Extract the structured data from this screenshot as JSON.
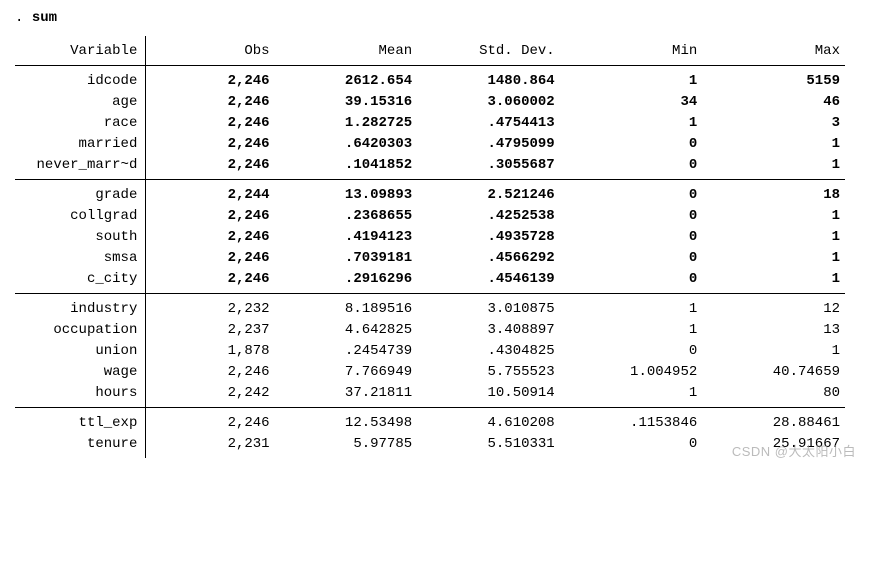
{
  "command_prefix": ". ",
  "command": "sum",
  "headers": {
    "variable": "Variable",
    "obs": "Obs",
    "mean": "Mean",
    "sd": "Std. Dev.",
    "min": "Min",
    "max": "Max"
  },
  "groups": [
    {
      "bold": true,
      "rows": [
        {
          "var": "idcode",
          "obs": "2,246",
          "mean": "2612.654",
          "sd": "1480.864",
          "min": "1",
          "max": "5159"
        },
        {
          "var": "age",
          "obs": "2,246",
          "mean": "39.15316",
          "sd": "3.060002",
          "min": "34",
          "max": "46"
        },
        {
          "var": "race",
          "obs": "2,246",
          "mean": "1.282725",
          "sd": ".4754413",
          "min": "1",
          "max": "3"
        },
        {
          "var": "married",
          "obs": "2,246",
          "mean": ".6420303",
          "sd": ".4795099",
          "min": "0",
          "max": "1"
        },
        {
          "var": "never_marr~d",
          "obs": "2,246",
          "mean": ".1041852",
          "sd": ".3055687",
          "min": "0",
          "max": "1"
        }
      ]
    },
    {
      "bold": true,
      "rows": [
        {
          "var": "grade",
          "obs": "2,244",
          "mean": "13.09893",
          "sd": "2.521246",
          "min": "0",
          "max": "18"
        },
        {
          "var": "collgrad",
          "obs": "2,246",
          "mean": ".2368655",
          "sd": ".4252538",
          "min": "0",
          "max": "1"
        },
        {
          "var": "south",
          "obs": "2,246",
          "mean": ".4194123",
          "sd": ".4935728",
          "min": "0",
          "max": "1"
        },
        {
          "var": "smsa",
          "obs": "2,246",
          "mean": ".7039181",
          "sd": ".4566292",
          "min": "0",
          "max": "1"
        },
        {
          "var": "c_city",
          "obs": "2,246",
          "mean": ".2916296",
          "sd": ".4546139",
          "min": "0",
          "max": "1"
        }
      ]
    },
    {
      "bold": false,
      "rows": [
        {
          "var": "industry",
          "obs": "2,232",
          "mean": "8.189516",
          "sd": "3.010875",
          "min": "1",
          "max": "12"
        },
        {
          "var": "occupation",
          "obs": "2,237",
          "mean": "4.642825",
          "sd": "3.408897",
          "min": "1",
          "max": "13"
        },
        {
          "var": "union",
          "obs": "1,878",
          "mean": ".2454739",
          "sd": ".4304825",
          "min": "0",
          "max": "1"
        },
        {
          "var": "wage",
          "obs": "2,246",
          "mean": "7.766949",
          "sd": "5.755523",
          "min": "1.004952",
          "max": "40.74659"
        },
        {
          "var": "hours",
          "obs": "2,242",
          "mean": "37.21811",
          "sd": "10.50914",
          "min": "1",
          "max": "80"
        }
      ]
    },
    {
      "bold": false,
      "rows": [
        {
          "var": "ttl_exp",
          "obs": "2,246",
          "mean": "12.53498",
          "sd": "4.610208",
          "min": ".1153846",
          "max": "28.88461"
        },
        {
          "var": "tenure",
          "obs": "2,231",
          "mean": "5.97785",
          "sd": "5.510331",
          "min": "0",
          "max": "25.91667"
        }
      ]
    }
  ],
  "watermark": "CSDN @大太阳小白"
}
